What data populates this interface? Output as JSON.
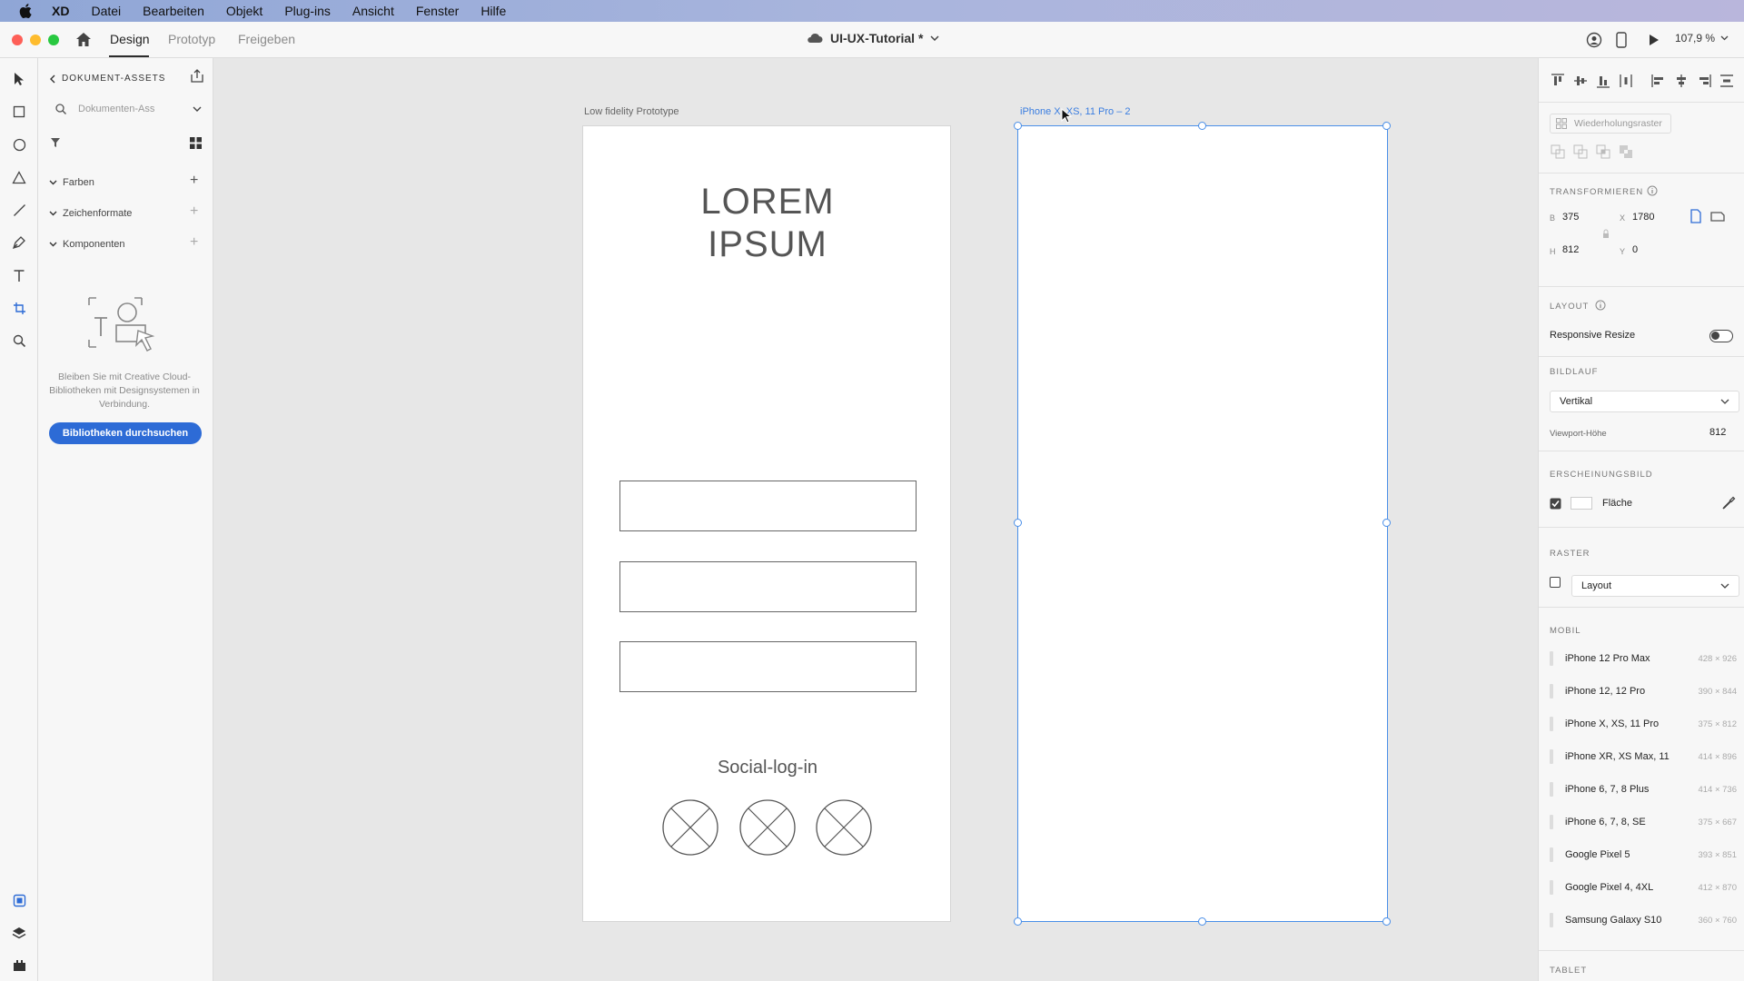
{
  "menubar": {
    "app": "XD",
    "items": [
      "Datei",
      "Bearbeiten",
      "Objekt",
      "Plug-ins",
      "Ansicht",
      "Fenster",
      "Hilfe"
    ]
  },
  "titlebar": {
    "tabs": [
      "Design",
      "Prototyp",
      "Freigeben"
    ],
    "active_tab": "Design",
    "doc_title": "UI-UX-Tutorial *",
    "zoom": "107,9 %"
  },
  "assets": {
    "header": "DOKUMENT-ASSETS",
    "search_placeholder": "Dokumenten-Ass",
    "sections": [
      "Farben",
      "Zeichenformate",
      "Komponenten"
    ],
    "empty_text": "Bleiben Sie mit Creative Cloud-Bibliotheken mit Designsystemen in Verbindung.",
    "library_button": "Bibliotheken durchsuchen"
  },
  "canvas": {
    "artboard1_label": "Low fidelity Prototype",
    "artboard1_title_line1": "LOREM",
    "artboard1_title_line2": "IPSUM",
    "social_label": "Social-log-in",
    "artboard2_label": "iPhone X, XS, 11 Pro – 2"
  },
  "inspector": {
    "repeat_grid": "Wiederholungsraster",
    "transform_title": "TRANSFORMIEREN",
    "w_label": "B",
    "w_value": "375",
    "x_label": "X",
    "x_value": "1780",
    "h_label": "H",
    "h_value": "812",
    "y_label": "Y",
    "y_value": "0",
    "layout_title": "LAYOUT",
    "responsive_resize": "Responsive Resize",
    "scroll_title": "BILDLAUF",
    "scroll_value": "Vertikal",
    "viewport_label": "Viewport-Höhe",
    "viewport_value": "812",
    "appearance_title": "ERSCHEINUNGSBILD",
    "fill_label": "Fläche",
    "grid_title": "RASTER",
    "grid_value": "Layout",
    "mobile_title": "MOBIL",
    "devices": [
      {
        "name": "iPhone 12 Pro Max",
        "size": "428 × 926"
      },
      {
        "name": "iPhone 12, 12 Pro",
        "size": "390 × 844"
      },
      {
        "name": "iPhone X, XS, 11 Pro",
        "size": "375 × 812"
      },
      {
        "name": "iPhone XR, XS Max, 11",
        "size": "414 × 896"
      },
      {
        "name": "iPhone 6, 7, 8 Plus",
        "size": "414 × 736"
      },
      {
        "name": "iPhone 6, 7, 8, SE",
        "size": "375 × 667"
      },
      {
        "name": "Google Pixel 5",
        "size": "393 × 851"
      },
      {
        "name": "Google Pixel 4, 4XL",
        "size": "412 × 870"
      },
      {
        "name": "Samsung Galaxy S10",
        "size": "360 × 760"
      }
    ],
    "tablet_title": "TABLET"
  },
  "colors": {
    "accent": "#2d6bd6",
    "selection": "#4a8fe8"
  }
}
